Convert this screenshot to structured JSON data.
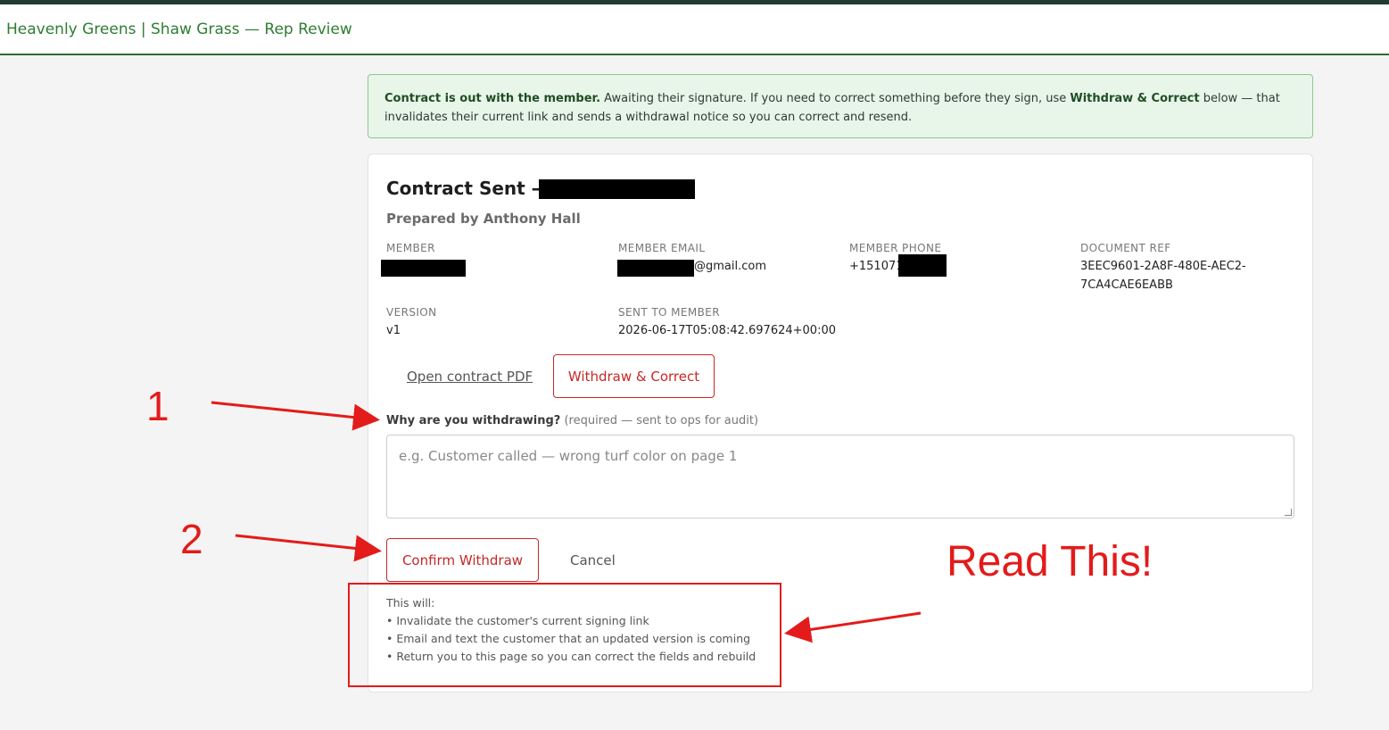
{
  "header": {
    "title": "Heavenly Greens | Shaw Grass — Rep Review"
  },
  "notice": {
    "bold_lead": "Contract is out with the member.",
    "text_1": " Awaiting their signature. If you need to correct something before they sign, use ",
    "bold_action": "Withdraw & Correct",
    "text_2": " below — that invalidates their current link and sends a withdrawal notice so you can correct and resend."
  },
  "card": {
    "title": "Contract Sent —",
    "prepared_by": "Prepared by Anthony Hall",
    "fields": {
      "member_label": "MEMBER",
      "member_email_label": "MEMBER EMAIL",
      "member_email_suffix": "@gmail.com",
      "member_phone_label": "MEMBER PHONE",
      "member_phone_prefix": "+151071",
      "document_ref_label": "DOCUMENT REF",
      "document_ref_line1": "3EEC9601-2A8F-480E-AEC2-",
      "document_ref_line2": "7CA4CAE6EABB",
      "version_label": "VERSION",
      "version_value": "v1",
      "sent_label": "SENT TO MEMBER",
      "sent_value": "2026-06-17T05:08:42.697624+00:00"
    },
    "open_pdf_label": "Open contract PDF",
    "withdraw_label": "Withdraw & Correct",
    "reason_label": "Why are you withdrawing?",
    "reason_hint": "(required — sent to ops for audit)",
    "reason_placeholder": "e.g. Customer called — wrong turf color on page 1",
    "confirm_label": "Confirm Withdraw",
    "cancel_label": "Cancel",
    "info_heading": "This will:",
    "info_items": [
      "• Invalidate the customer's current signing link",
      "• Email and text the customer that an updated version is coming",
      "• Return you to this page so you can correct the fields and rebuild"
    ]
  },
  "annotations": {
    "step1": "1",
    "step2": "2",
    "read_this": "Read This!",
    "color": "#e31b1b"
  }
}
